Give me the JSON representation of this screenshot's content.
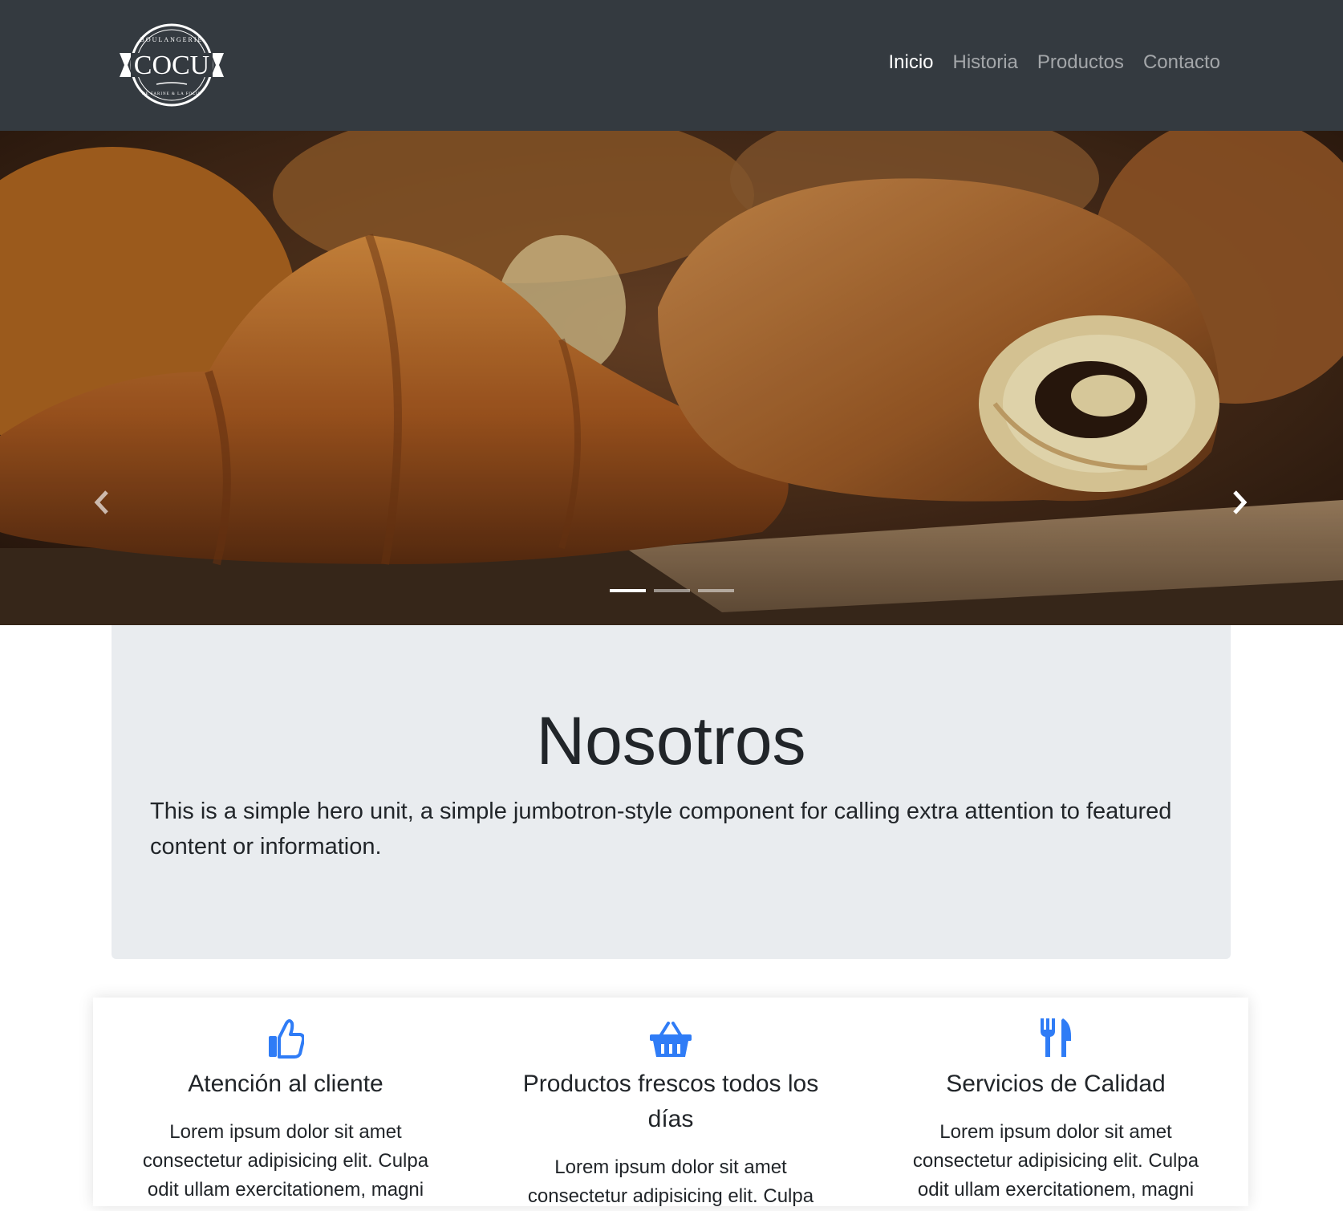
{
  "brand": {
    "name": "COCU",
    "top_text": "BOULANGERIE",
    "bottom_text": "DE FARINE & LA FOLIE"
  },
  "nav": {
    "items": [
      {
        "label": "Inicio",
        "active": true
      },
      {
        "label": "Historia",
        "active": false
      },
      {
        "label": "Productos",
        "active": false
      },
      {
        "label": "Contacto",
        "active": false
      }
    ]
  },
  "carousel": {
    "slides": 3,
    "active_slide": 1,
    "prev_icon": "chevron-left-icon",
    "next_icon": "chevron-right-icon"
  },
  "jumbotron": {
    "title": "Nosotros",
    "text": "This is a simple hero unit, a simple jumbotron-style component for calling extra attention to featured content or information."
  },
  "features": [
    {
      "icon": "thumbs-up-icon",
      "title": "Atención al cliente",
      "text": "Lorem ipsum dolor sit amet consectetur adipisicing elit. Culpa odit ullam exercitationem, magni"
    },
    {
      "icon": "shopping-basket-icon",
      "title": "Productos frescos todos los días",
      "text": "Lorem ipsum dolor sit amet consectetur adipisicing elit. Culpa"
    },
    {
      "icon": "utensils-icon",
      "title": "Servicios de Calidad",
      "text": "Lorem ipsum dolor sit amet consectetur adipisicing elit. Culpa odit ullam exercitationem, magni"
    }
  ],
  "colors": {
    "navbar_bg": "#343a40",
    "jumbotron_bg": "#e9ecef",
    "icon_accent": "#2f7cf6"
  }
}
